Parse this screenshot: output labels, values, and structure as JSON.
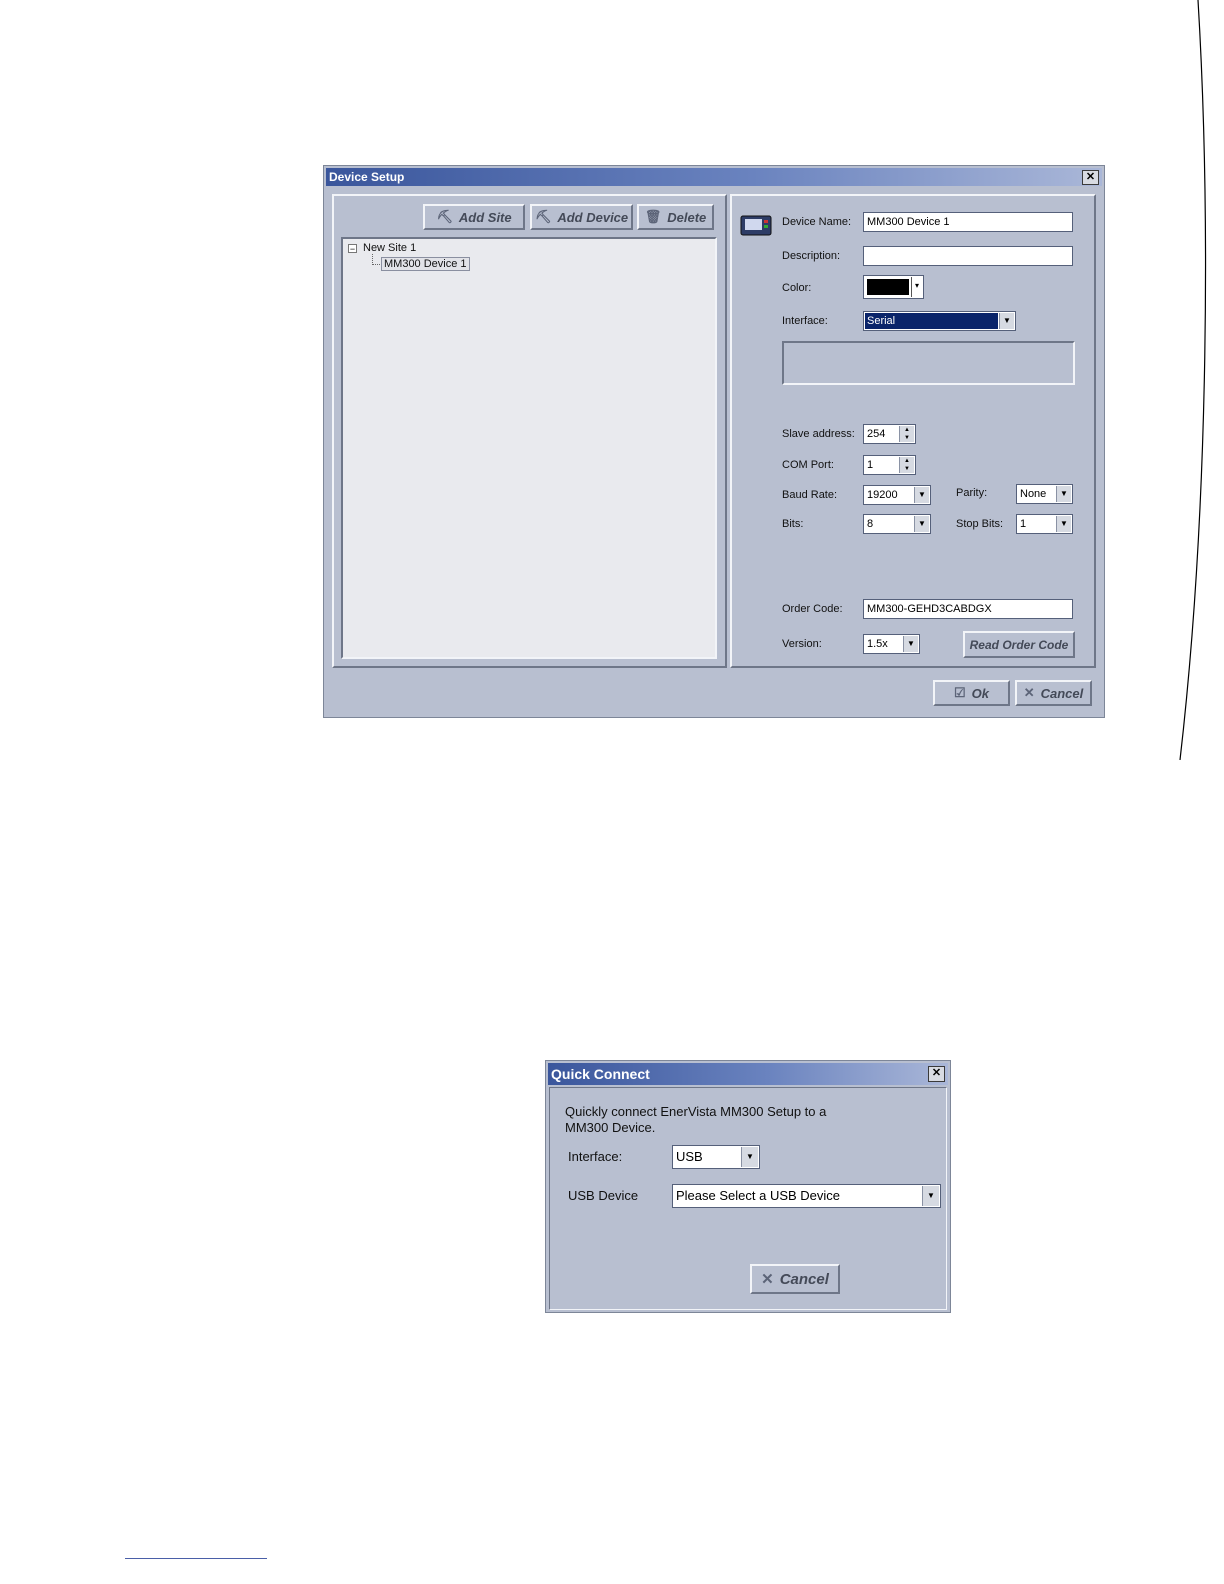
{
  "device_setup": {
    "title": "Device Setup",
    "close_glyph": "✕",
    "toolbar": {
      "add_site": "Add Site",
      "add_device": "Add Device",
      "delete": "Delete",
      "add_site_icon": "add-site-icon",
      "add_device_icon": "add-device-icon",
      "delete_icon": "trash-icon"
    },
    "tree": {
      "site": "New Site 1",
      "device": "MM300 Device 1"
    },
    "form": {
      "device_name_label": "Device Name:",
      "device_name_value": "MM300 Device 1",
      "description_label": "Description:",
      "description_value": "",
      "color_label": "Color:",
      "color_value": "#000000",
      "interface_label": "Interface:",
      "interface_value": "Serial",
      "slave_address_label": "Slave address:",
      "slave_address_value": "254",
      "com_port_label": "COM Port:",
      "com_port_value": "1",
      "baud_rate_label": "Baud Rate:",
      "baud_rate_value": "19200",
      "parity_label": "Parity:",
      "parity_value": "None",
      "bits_label": "Bits:",
      "bits_value": "8",
      "stop_bits_label": "Stop Bits:",
      "stop_bits_value": "1",
      "order_code_label": "Order Code:",
      "order_code_value": "MM300-GEHD3CABDGX",
      "version_label": "Version:",
      "version_value": "1.5x",
      "read_order_code": "Read Order Code"
    },
    "ok_label": "Ok",
    "cancel_label": "Cancel"
  },
  "quick_connect": {
    "title": "Quick Connect",
    "close_glyph": "✕",
    "intro_line1": "Quickly connect EnerVista MM300 Setup to a",
    "intro_line2": "MM300 Device.",
    "interface_label": "Interface:",
    "interface_value": "USB",
    "usb_device_label": "USB Device",
    "usb_device_value": "Please Select a USB Device",
    "cancel_label": "Cancel"
  }
}
